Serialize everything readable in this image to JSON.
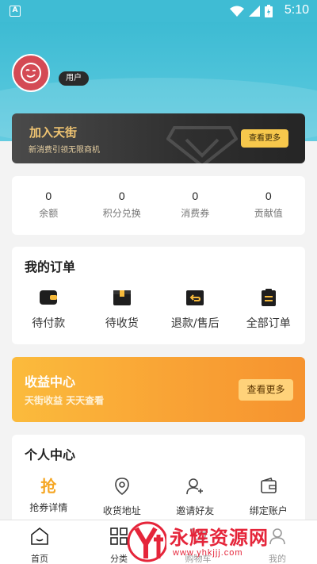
{
  "status_bar": {
    "badge": "A",
    "time": "5:10"
  },
  "user": {
    "tag": "用户"
  },
  "join": {
    "title": "加入天街",
    "subtitle": "新消费引领无限商机",
    "button": "查看更多"
  },
  "stats": [
    {
      "value": "0",
      "label": "余额"
    },
    {
      "value": "0",
      "label": "积分兑换"
    },
    {
      "value": "0",
      "label": "消费券"
    },
    {
      "value": "0",
      "label": "贡献值"
    }
  ],
  "orders": {
    "title": "我的订单",
    "items": [
      {
        "label": "待付款",
        "icon": "wallet-icon"
      },
      {
        "label": "待收货",
        "icon": "box-icon"
      },
      {
        "label": "退款/售后",
        "icon": "refund-icon"
      },
      {
        "label": "全部订单",
        "icon": "clipboard-icon"
      }
    ]
  },
  "earnings": {
    "title": "收益中心",
    "subtitle": "天街收益 天天查看",
    "button": "查看更多"
  },
  "personal": {
    "title": "个人中心",
    "items": [
      {
        "label": "抢券详情",
        "icon": "grab-icon",
        "glyph": "抢"
      },
      {
        "label": "收货地址",
        "icon": "location-pin-icon"
      },
      {
        "label": "邀请好友",
        "icon": "add-user-icon"
      },
      {
        "label": "绑定账户",
        "icon": "wallet-card-icon"
      }
    ]
  },
  "tabs": [
    {
      "label": "首页",
      "icon": "home-icon"
    },
    {
      "label": "分类",
      "icon": "category-grid-icon"
    },
    {
      "label": "购物车",
      "icon": "cart-icon"
    },
    {
      "label": "我的",
      "icon": "user-icon"
    }
  ],
  "watermark": {
    "text": "永辉资源网",
    "url": "www.yhkjjj.com"
  },
  "colors": {
    "header": "#3dbbd3",
    "accent_gold": "#f7c84c",
    "accent_orange": "#f9a335",
    "watermark": "#e5253a"
  }
}
